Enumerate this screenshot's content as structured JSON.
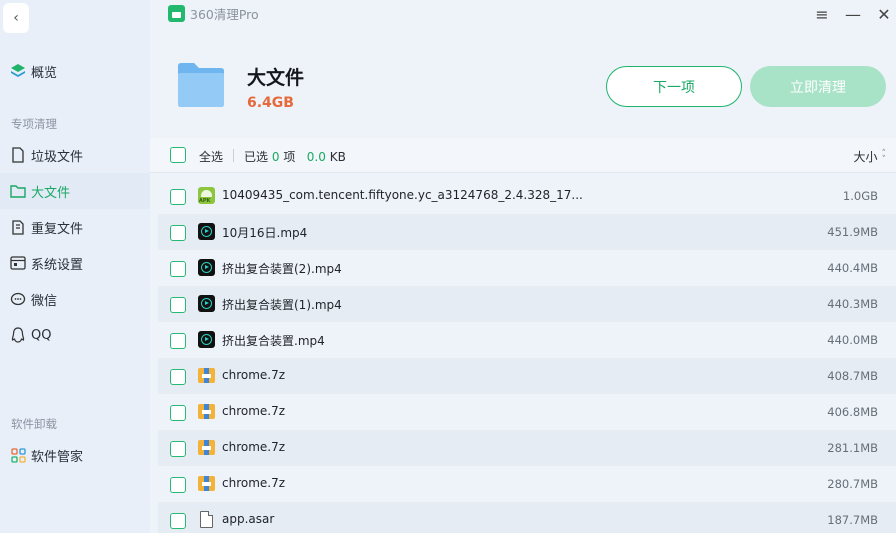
{
  "app": {
    "title": "360清理Pro"
  },
  "sidebar": {
    "overview": "概览",
    "section_cleanup": "专项清理",
    "items": [
      {
        "label": "垃圾文件",
        "icon": "trash-file-icon"
      },
      {
        "label": "大文件",
        "icon": "folder-icon",
        "active": true
      },
      {
        "label": "重复文件",
        "icon": "duplicate-file-icon"
      },
      {
        "label": "系统设置",
        "icon": "settings-window-icon"
      },
      {
        "label": "微信",
        "icon": "wechat-icon"
      },
      {
        "label": "QQ",
        "icon": "qq-icon"
      }
    ],
    "section_uninstall": "软件卸载",
    "software_manager": "软件管家"
  },
  "header": {
    "title": "大文件",
    "size": "6.4GB",
    "next_label": "下一项",
    "clean_label": "立即清理"
  },
  "toolbar": {
    "select_all": "全选",
    "selected_prefix": "已选",
    "selected_count": "0",
    "count_unit": "项",
    "selected_size": "0.0",
    "size_unit": "KB",
    "sort_label": "大小"
  },
  "files": [
    {
      "name": "10409435_com.tencent.fiftyone.yc_a3124768_2.4.328_17...",
      "size": "1.0GB",
      "type": "apk"
    },
    {
      "name": "10月16日.mp4",
      "size": "451.9MB",
      "type": "mp4"
    },
    {
      "name": "挤出复合装置(2).mp4",
      "size": "440.4MB",
      "type": "mp4"
    },
    {
      "name": "挤出复合装置(1).mp4",
      "size": "440.3MB",
      "type": "mp4"
    },
    {
      "name": "挤出复合装置.mp4",
      "size": "440.0MB",
      "type": "mp4"
    },
    {
      "name": "chrome.7z",
      "size": "408.7MB",
      "type": "7z"
    },
    {
      "name": "chrome.7z",
      "size": "406.8MB",
      "type": "7z"
    },
    {
      "name": "chrome.7z",
      "size": "281.1MB",
      "type": "7z"
    },
    {
      "name": "chrome.7z",
      "size": "280.7MB",
      "type": "7z"
    },
    {
      "name": "app.asar",
      "size": "187.7MB",
      "type": "file"
    }
  ],
  "colors": {
    "accent": "#1aa864",
    "size_highlight": "#e5693a",
    "clean_button": "#a9e3c7"
  }
}
